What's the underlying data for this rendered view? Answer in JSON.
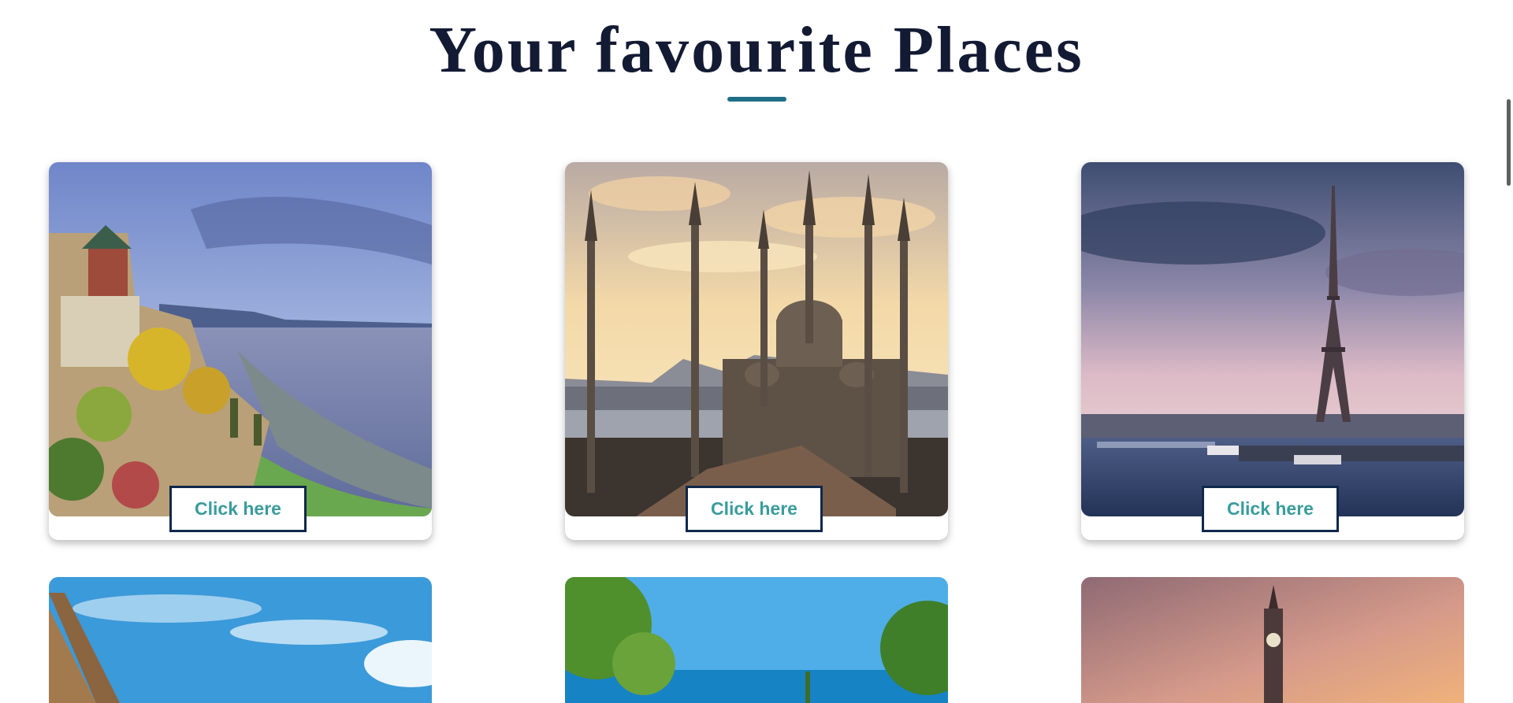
{
  "page": {
    "title": "Your favourite Places",
    "accent_color": "#1f6f86",
    "button_text_color": "#3a9c9c",
    "button_border_color": "#10284a"
  },
  "places": [
    {
      "button_label": "Click here",
      "scene": "quebec-chateau-river"
    },
    {
      "button_label": "Click here",
      "scene": "istanbul-blue-mosque"
    },
    {
      "button_label": "Click here",
      "scene": "paris-eiffel-tower"
    },
    {
      "scene": "thatched-roof-blue-sky"
    },
    {
      "scene": "sea-view-trees"
    },
    {
      "scene": "mecca-clock-tower"
    }
  ]
}
